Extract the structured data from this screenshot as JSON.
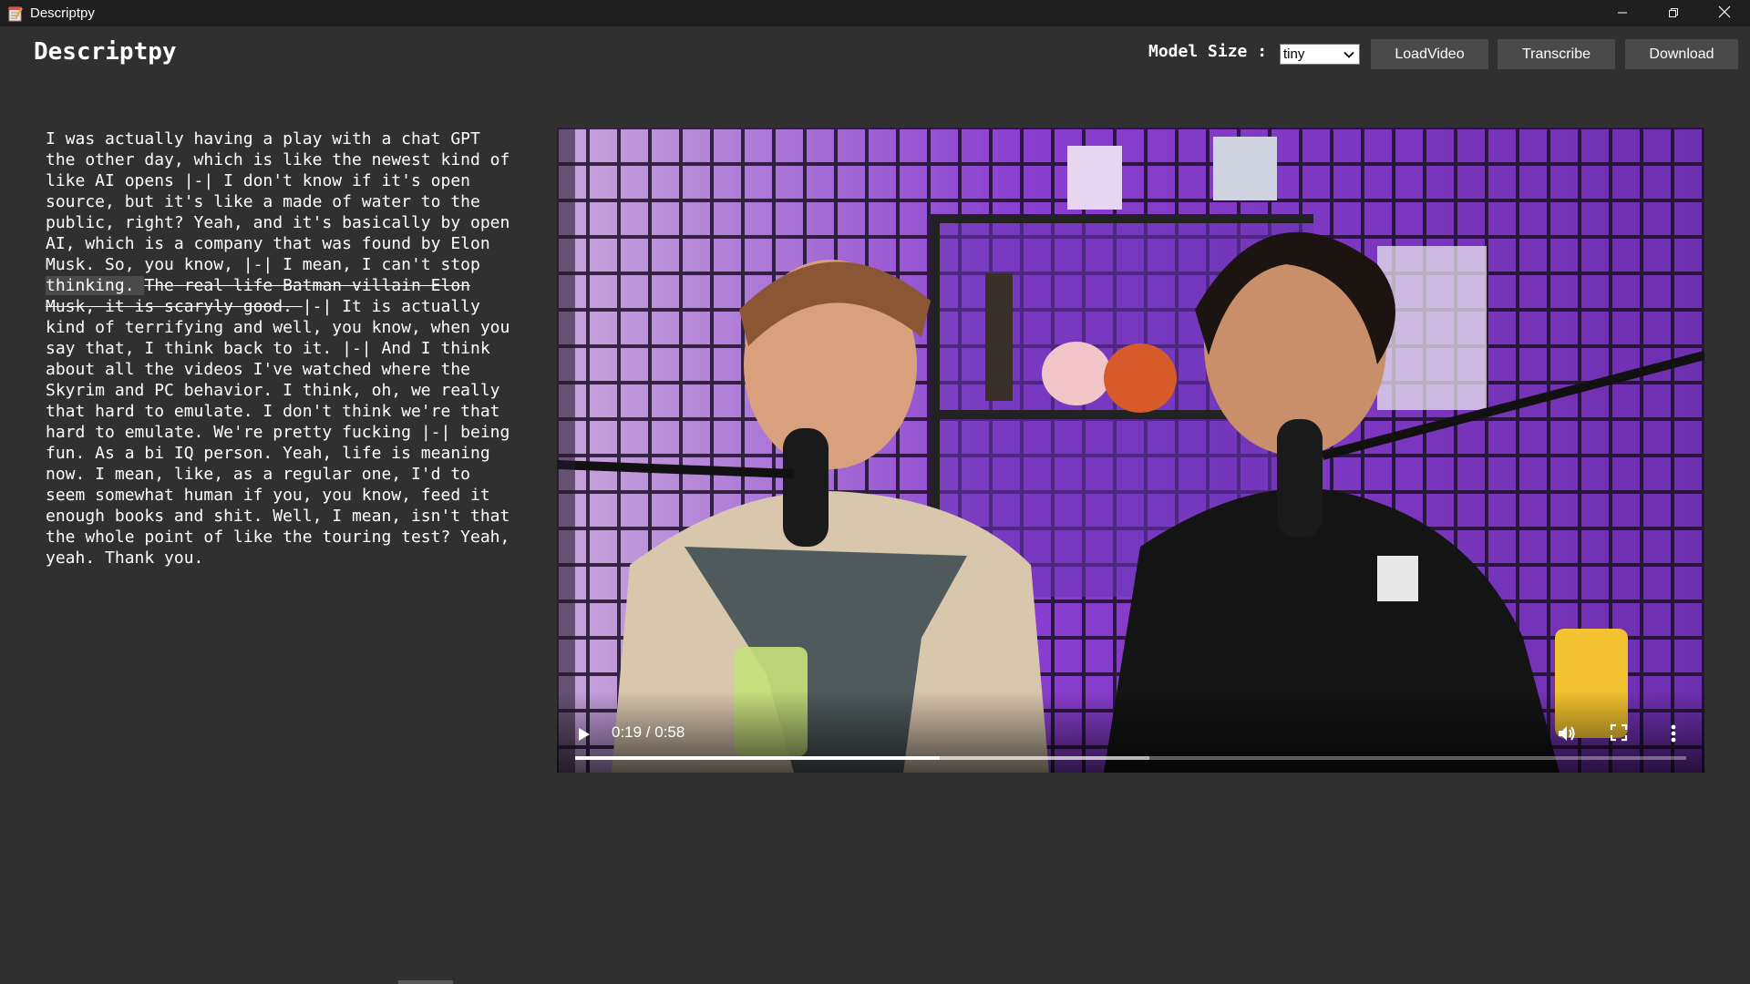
{
  "window": {
    "title": "Descriptpy",
    "controls": [
      "minimize-icon",
      "restore-icon",
      "close-icon"
    ]
  },
  "header": {
    "app_title": "Descriptpy",
    "model_label": "Model Size :",
    "model_select": {
      "value": "tiny"
    },
    "buttons": {
      "load_video": "LoadVideo",
      "transcribe": "Transcribe",
      "download": "Download"
    }
  },
  "transcript": {
    "segments": [
      {
        "text": "I was actually having a play with a chat GPT the other day, which is like the newest kind of like AI opens ",
        "style": "normal"
      },
      {
        "text": "|-|",
        "style": "normal"
      },
      {
        "text": " I don't know if it's open source, but it's like a made of water to the public, right? Yeah, and it's basically by open AI, which is a company that was found by Elon Musk. So, you know, ",
        "style": "normal"
      },
      {
        "text": "|-|",
        "style": "normal"
      },
      {
        "text": " I mean, I can't stop ",
        "style": "normal"
      },
      {
        "text": "thinking. ",
        "style": "highlighted"
      },
      {
        "text": "The real life Batman villain Elon Musk, it is scaryly good. ",
        "style": "struck"
      },
      {
        "text": "|-|",
        "style": "normal"
      },
      {
        "text": " It is actually kind of terrifying and well, you know, when you say that, I think back to it. ",
        "style": "normal"
      },
      {
        "text": "|-|",
        "style": "normal"
      },
      {
        "text": " And I think about all the videos I've watched where the Skyrim and PC behavior. I think, oh, we really that hard to emulate. I don't think we're that hard to emulate. We're pretty fucking ",
        "style": "normal"
      },
      {
        "text": "|-|",
        "style": "normal"
      },
      {
        "text": " being fun. As a bi IQ person. Yeah, life is meaning now. I mean, like, as a regular one, I'd to seem somewhat human if you, you know, feed it enough books and shit. Well, I mean, isn't that the whole point of like the touring test? Yeah, yeah. Thank you.",
        "style": "normal"
      }
    ]
  },
  "video": {
    "time_display": "0:19 / 0:58",
    "progress_fraction": 0.328,
    "buffered_fraction": 0.517,
    "icons": [
      "play-icon",
      "volume-icon",
      "fullscreen-icon",
      "more-options-icon"
    ],
    "accent_color": "#7c3fb0"
  }
}
